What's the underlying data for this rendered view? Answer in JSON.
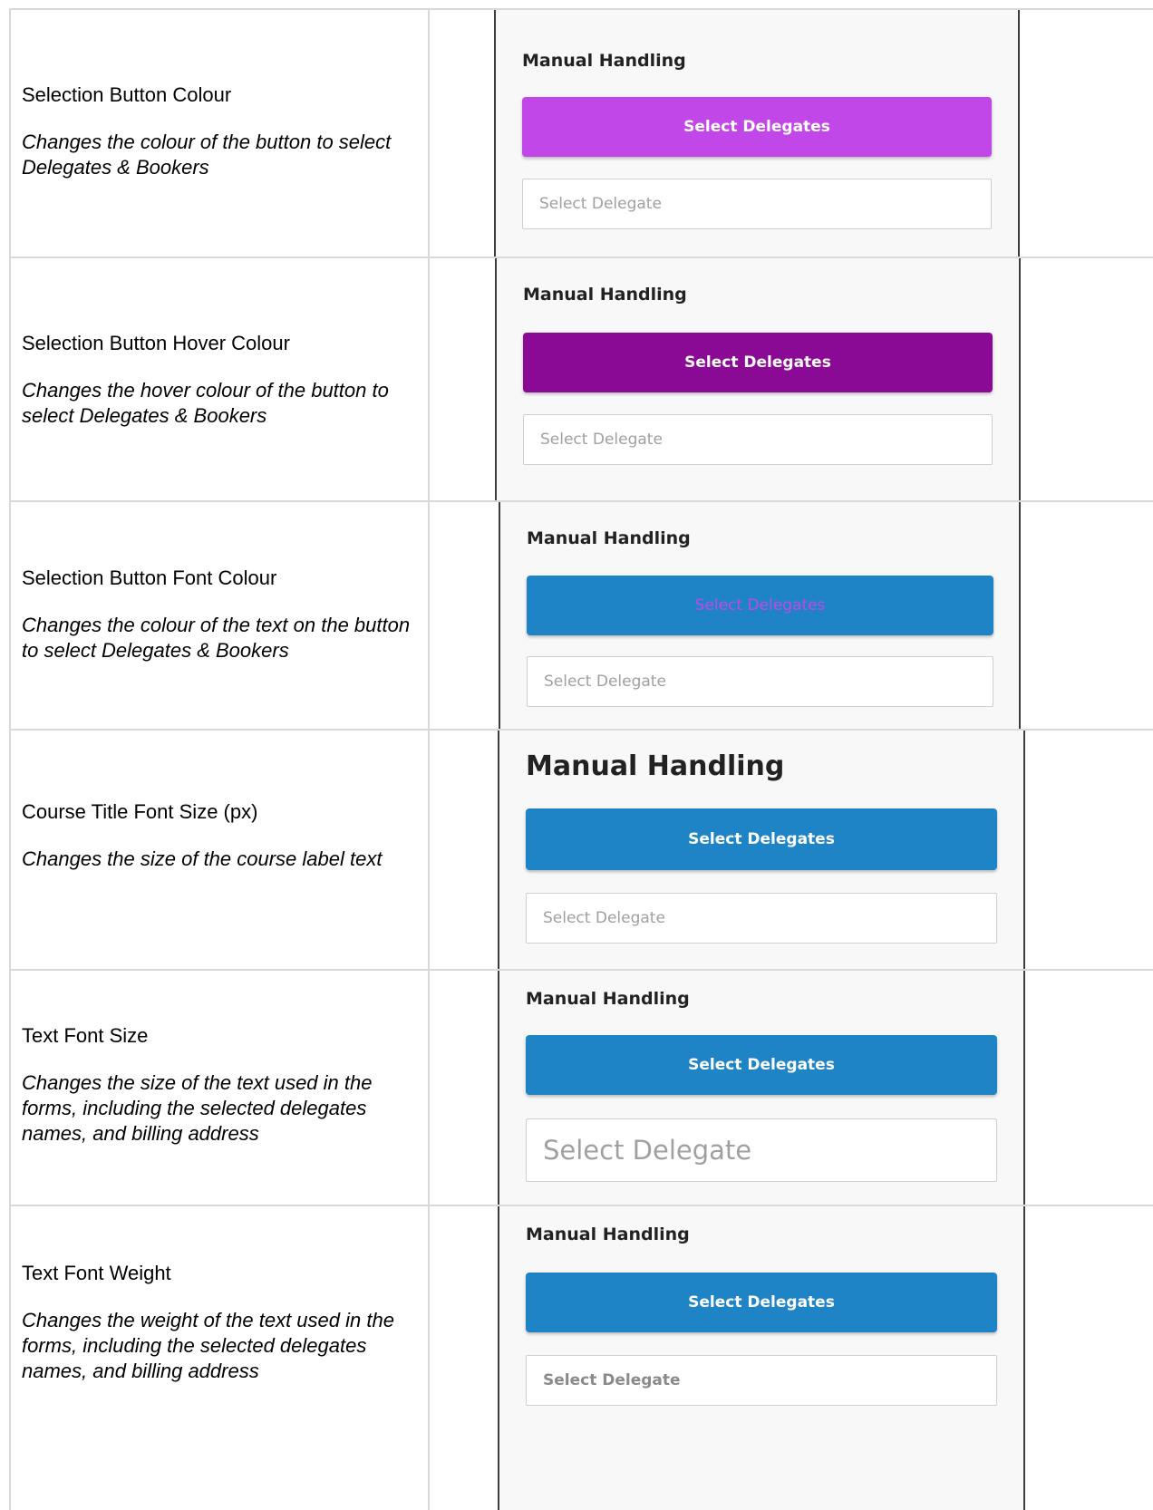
{
  "colors": {
    "select_button": "#c247e8",
    "select_button_hover": "#8b0a95",
    "default_button": "#1f84c6",
    "font_colour_example": "#c247e8"
  },
  "rows": [
    {
      "name": "Selection Button Colour",
      "description": "Changes the colour of the button to select Delegates & Bookers",
      "preview": {
        "course_title": "Manual Handling",
        "button_label": "Select Delegates",
        "input_placeholder": "Select Delegate"
      }
    },
    {
      "name": "Selection Button Hover Colour",
      "description": "Changes the hover colour of the button to select Delegates & Bookers",
      "preview": {
        "course_title": "Manual Handling",
        "button_label": "Select Delegates",
        "input_placeholder": "Select Delegate"
      }
    },
    {
      "name": "Selection Button Font Colour",
      "description": "Changes the colour of the text on the button to select Delegates & Bookers",
      "preview": {
        "course_title": "Manual Handling",
        "button_label": "Select Delegates",
        "input_placeholder": "Select Delegate"
      }
    },
    {
      "name": "Course Title Font Size (px)",
      "description": "Changes the size of the course label text",
      "preview": {
        "course_title": "Manual Handling",
        "button_label": "Select Delegates",
        "input_placeholder": "Select Delegate"
      }
    },
    {
      "name": "Text Font Size",
      "description": "Changes the size of the text used in the forms, including the selected delegates names, and billing address",
      "preview": {
        "course_title": "Manual Handling",
        "button_label": "Select Delegates",
        "input_placeholder": "Select Delegate"
      }
    },
    {
      "name": "Text Font Weight",
      "description": "Changes the weight of the text used in the forms, including the selected delegates names, and billing address",
      "preview": {
        "course_title": "Manual Handling",
        "button_label": "Select Delegates",
        "input_placeholder": "Select Delegate"
      }
    }
  ]
}
